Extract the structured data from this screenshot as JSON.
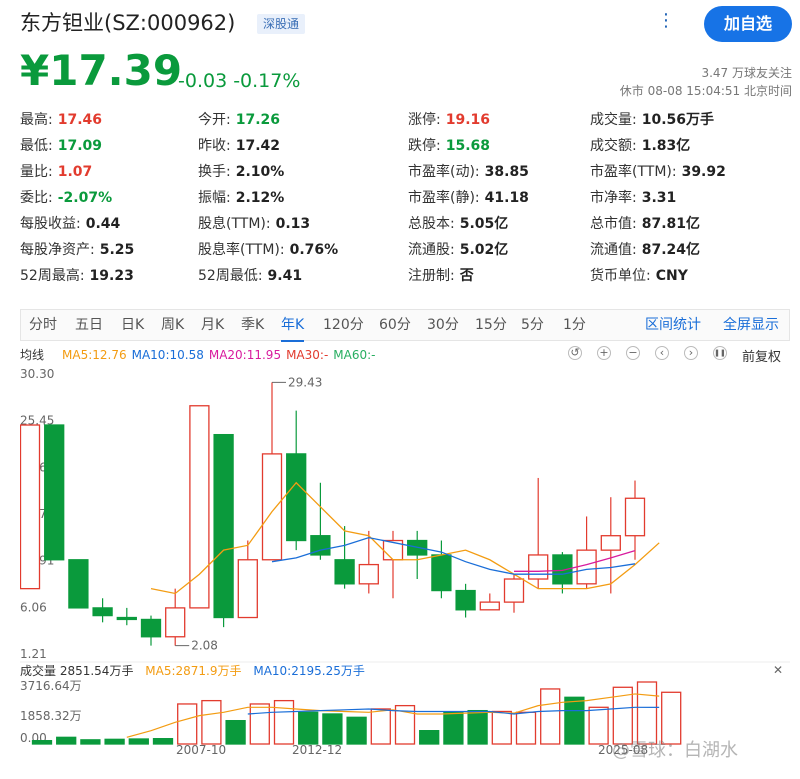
{
  "header": {
    "name": "东方钽业(SZ:000962)",
    "tag": "深股通",
    "more_icon": "ellipsis-vertical-icon",
    "add_label": "加自选"
  },
  "quote": {
    "price": "¥17.39",
    "change": "-0.03 -0.17%",
    "followers": "3.47 万球友关注",
    "time": "休市 08-08 15:04:51 北京时间"
  },
  "stats": [
    {
      "k": "最高:",
      "v": "17.46",
      "c": "up"
    },
    {
      "k": "今开:",
      "v": "17.26",
      "c": "down"
    },
    {
      "k": "涨停:",
      "v": "19.16",
      "c": "up"
    },
    {
      "k": "成交量:",
      "v": "10.56万手",
      "c": "flat"
    },
    {
      "k": "最低:",
      "v": "17.09",
      "c": "down"
    },
    {
      "k": "昨收:",
      "v": "17.42",
      "c": "flat"
    },
    {
      "k": "跌停:",
      "v": "15.68",
      "c": "down"
    },
    {
      "k": "成交额:",
      "v": "1.83亿",
      "c": "flat"
    },
    {
      "k": "量比:",
      "v": "1.07",
      "c": "up"
    },
    {
      "k": "换手:",
      "v": "2.10%",
      "c": "flat"
    },
    {
      "k": "市盈率(动):",
      "v": "38.85",
      "c": "flat"
    },
    {
      "k": "市盈率(TTM):",
      "v": "39.92",
      "c": "flat"
    },
    {
      "k": "委比:",
      "v": "-2.07%",
      "c": "down"
    },
    {
      "k": "振幅:",
      "v": "2.12%",
      "c": "flat"
    },
    {
      "k": "市盈率(静):",
      "v": "41.18",
      "c": "flat"
    },
    {
      "k": "市净率:",
      "v": "3.31",
      "c": "flat"
    },
    {
      "k": "每股收益:",
      "v": "0.44",
      "c": "flat"
    },
    {
      "k": "股息(TTM):",
      "v": "0.13",
      "c": "flat"
    },
    {
      "k": "总股本:",
      "v": "5.05亿",
      "c": "flat"
    },
    {
      "k": "总市值:",
      "v": "87.81亿",
      "c": "flat"
    },
    {
      "k": "每股净资产:",
      "v": "5.25",
      "c": "flat"
    },
    {
      "k": "股息率(TTM):",
      "v": "0.76%",
      "c": "flat"
    },
    {
      "k": "流通股:",
      "v": "5.02亿",
      "c": "flat"
    },
    {
      "k": "流通值:",
      "v": "87.24亿",
      "c": "flat"
    },
    {
      "k": "52周最高:",
      "v": "19.23",
      "c": "flat"
    },
    {
      "k": "52周最低:",
      "v": "9.41",
      "c": "flat"
    },
    {
      "k": "注册制:",
      "v": "否",
      "c": "flat"
    },
    {
      "k": "货币单位:",
      "v": "CNY",
      "c": "flat"
    }
  ],
  "tabs": [
    "分时",
    "五日",
    "日K",
    "周K",
    "月K",
    "季K",
    "年K",
    "120分",
    "60分",
    "30分",
    "15分",
    "5分",
    "1分"
  ],
  "active_tab": "年K",
  "tab_actions": [
    "区间统计",
    "全屏显示"
  ],
  "ma": {
    "label": "均线",
    "items": [
      {
        "text": "MA5:12.76",
        "color": "#f39c12"
      },
      {
        "text": "MA10:10.58",
        "color": "#1a6ed8"
      },
      {
        "text": "MA20:11.95",
        "color": "#d81b9e"
      },
      {
        "text": "MA30:-",
        "color": "#e23b2e"
      },
      {
        "text": "MA60:-",
        "color": "#27ae60"
      }
    ]
  },
  "tools": [
    "undo-icon",
    "zoom-in-icon",
    "zoom-out-icon",
    "scroll-left-icon",
    "scroll-right-icon",
    "pause-icon"
  ],
  "adjust_label": "前复权",
  "volume": {
    "label": "成交量 2851.54万手",
    "ma5": "MA5:2871.9万手",
    "ma10": "MA10:2195.25万手",
    "close_icon": "close-icon"
  },
  "watermark": "@雪球：白湖水",
  "colors": {
    "up": "#e23b2e",
    "down": "#0a9a3c",
    "accent": "#1773e6"
  },
  "chart_data": {
    "type": "candlestick",
    "y_ticks": [
      "30.30",
      "25.45",
      "20.61",
      "15.76",
      "10.91",
      "6.06",
      "1.21"
    ],
    "ylim": [
      1.21,
      30.3
    ],
    "annotations": [
      {
        "text": "29.43",
        "value": 29.43,
        "index": 10
      },
      {
        "text": "2.08",
        "value": 2.08,
        "index": 6
      }
    ],
    "x_ticks": [
      {
        "text": "2007-10",
        "index": 7
      },
      {
        "text": "2012-12",
        "index": 12
      },
      {
        "text": "2025-08",
        "index": 25
      }
    ],
    "candles": [
      {
        "o": 8.0,
        "c": 25.0,
        "h": 25.0,
        "l": 8.0
      },
      {
        "o": 25.0,
        "c": 11.0,
        "h": 25.0,
        "l": 11.0
      },
      {
        "o": 11.0,
        "c": 6.0,
        "h": 11.0,
        "l": 6.0
      },
      {
        "o": 6.0,
        "c": 5.2,
        "h": 7.0,
        "l": 4.5
      },
      {
        "o": 5.0,
        "c": 4.8,
        "h": 6.0,
        "l": 4.2
      },
      {
        "o": 4.8,
        "c": 3.0,
        "h": 5.2,
        "l": 2.08
      },
      {
        "o": 3.0,
        "c": 6.0,
        "h": 8.0,
        "l": 2.08
      },
      {
        "o": 6.0,
        "c": 27.0,
        "h": 27.0,
        "l": 6.0
      },
      {
        "o": 24.0,
        "c": 5.0,
        "h": 24.0,
        "l": 4.0
      },
      {
        "o": 5.0,
        "c": 11.0,
        "h": 13.0,
        "l": 5.0
      },
      {
        "o": 11.0,
        "c": 22.0,
        "h": 29.43,
        "l": 11.0
      },
      {
        "o": 22.0,
        "c": 13.0,
        "h": 26.5,
        "l": 12.0
      },
      {
        "o": 13.5,
        "c": 11.5,
        "h": 19.0,
        "l": 11.0
      },
      {
        "o": 11.0,
        "c": 8.5,
        "h": 14.5,
        "l": 8.0
      },
      {
        "o": 8.5,
        "c": 10.5,
        "h": 14.0,
        "l": 7.5
      },
      {
        "o": 11.0,
        "c": 13.0,
        "h": 14.0,
        "l": 7.0
      },
      {
        "o": 13.0,
        "c": 11.5,
        "h": 14.0,
        "l": 9.0
      },
      {
        "o": 11.5,
        "c": 7.8,
        "h": 13.0,
        "l": 7.0
      },
      {
        "o": 7.8,
        "c": 5.8,
        "h": 8.5,
        "l": 5.0
      },
      {
        "o": 5.8,
        "c": 6.6,
        "h": 7.5,
        "l": 5.8
      },
      {
        "o": 6.6,
        "c": 9.0,
        "h": 9.5,
        "l": 5.5
      },
      {
        "o": 9.0,
        "c": 11.5,
        "h": 19.5,
        "l": 8.0
      },
      {
        "o": 11.5,
        "c": 8.5,
        "h": 11.8,
        "l": 7.5
      },
      {
        "o": 8.5,
        "c": 12.0,
        "h": 15.5,
        "l": 8.0
      },
      {
        "o": 12.0,
        "c": 13.5,
        "h": 17.5,
        "l": 7.5
      },
      {
        "o": 13.5,
        "c": 17.39,
        "h": 19.23,
        "l": 11.0
      }
    ],
    "series": [
      {
        "name": "MA5",
        "start": 5,
        "values": [
          8.0,
          7.5,
          9.5,
          12.0,
          12.5,
          16.0,
          19.0,
          16.5,
          14.0,
          13.5,
          11.0,
          11.0,
          11.5,
          12.0,
          11.0,
          9.5,
          8.0,
          8.0,
          8.0,
          8.5,
          10.5,
          12.76
        ]
      },
      {
        "name": "MA10",
        "start": 10,
        "values": [
          10.8,
          11.2,
          12.0,
          12.5,
          13.3,
          12.8,
          12.3,
          11.8,
          10.8,
          10.0,
          9.5,
          9.5,
          9.5,
          10.0,
          10.2,
          10.58
        ]
      },
      {
        "name": "MA20",
        "start": 20,
        "values": [
          9.8,
          9.8,
          9.9,
          10.5,
          11.2,
          11.95
        ]
      }
    ],
    "volume": {
      "y_ticks": [
        "3716.64万",
        "1858.32万",
        "0.00"
      ],
      "ylim": [
        0,
        3716.64
      ],
      "values": [
        200,
        400,
        250,
        280,
        300,
        320,
        2400,
        2600,
        1400,
        2400,
        2600,
        1900,
        1800,
        1600,
        2100,
        2300,
        800,
        1900,
        2000,
        1950,
        1900,
        3300,
        2800,
        2200,
        3400,
        3716.64,
        3100
      ],
      "colors": [
        "d",
        "d",
        "d",
        "d",
        "d",
        "d",
        "u",
        "u",
        "d",
        "u",
        "u",
        "d",
        "d",
        "d",
        "u",
        "u",
        "d",
        "d",
        "d",
        "u",
        "u",
        "u",
        "d",
        "u",
        "u",
        "u",
        "u"
      ],
      "ma5": [
        null,
        null,
        null,
        null,
        400,
        800,
        1300,
        1700,
        1900,
        2200,
        2200,
        2100,
        2000,
        1950,
        1900,
        2050,
        1800,
        1800,
        1850,
        1900,
        1850,
        2300,
        2500,
        2600,
        2800,
        3000,
        2871.9
      ],
      "ma10": [
        null,
        null,
        null,
        null,
        null,
        null,
        null,
        null,
        null,
        1800,
        1900,
        1950,
        2000,
        2050,
        2100,
        2000,
        1950,
        1950,
        1950,
        1950,
        1800,
        1950,
        2000,
        2000,
        2100,
        2200,
        2195.25
      ]
    }
  }
}
